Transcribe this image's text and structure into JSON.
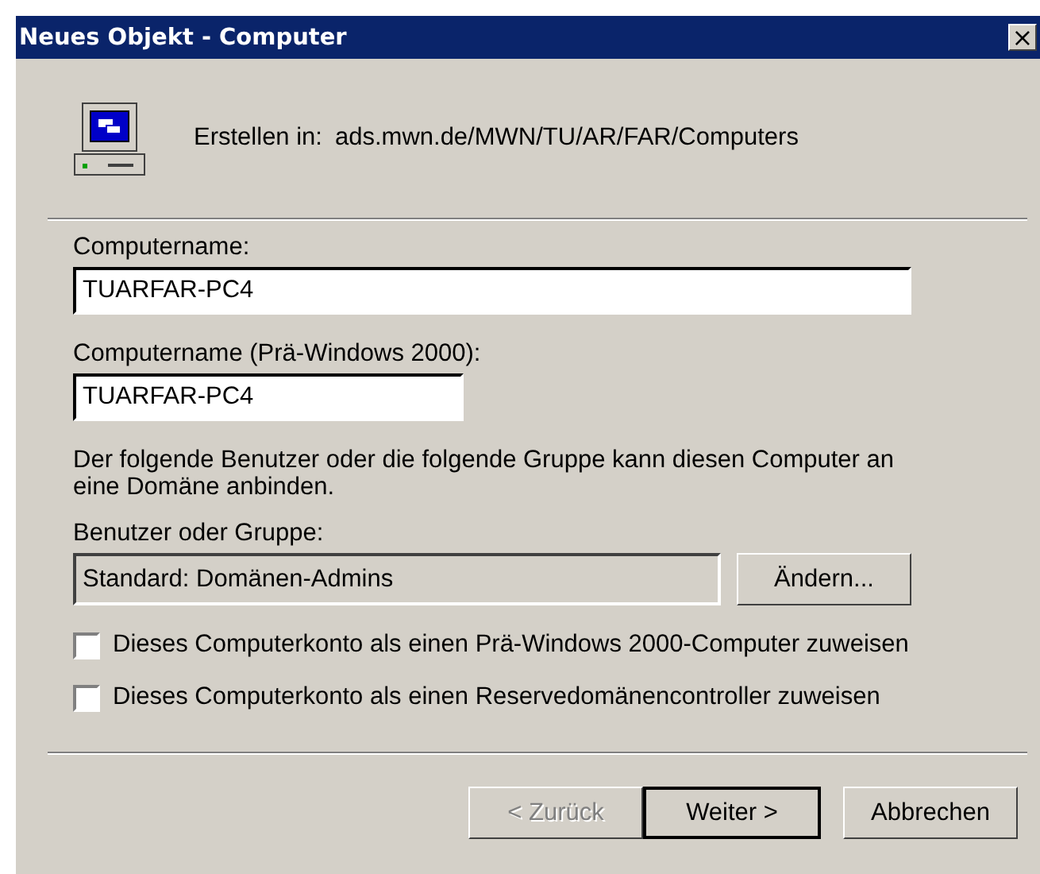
{
  "window": {
    "title": "Neues Objekt - Computer",
    "close": "×"
  },
  "header": {
    "label": "Erstellen in:",
    "path": "ads.mwn.de/MWN/TU/AR/FAR/Computers"
  },
  "fields": [
    {
      "label": "Computername:",
      "value": "TUARFAR-PC4"
    },
    {
      "label": "Computername (Prä-Windows 2000):",
      "value": "TUARFAR-PC4"
    }
  ],
  "description": "Der folgende Benutzer oder die folgende Gruppe kann diesen Computer an eine Domäne anbinden.",
  "group": {
    "label": "Benutzer oder Gruppe:",
    "value": "Standard: Domänen-Admins",
    "button": "Ändern..."
  },
  "checkboxes": [
    {
      "label": "Dieses Computerkonto als einen Prä-Windows 2000-Computer zuweisen",
      "checked": false
    },
    {
      "label": "Dieses Computerkonto als einen Reservedomänencontroller zuweisen",
      "checked": false
    }
  ],
  "buttons": [
    {
      "label": "< Zurück",
      "disabled": true,
      "default": false
    },
    {
      "label": "Weiter >",
      "disabled": false,
      "default": true
    },
    {
      "label": "Abbrechen",
      "disabled": false,
      "default": false
    }
  ]
}
